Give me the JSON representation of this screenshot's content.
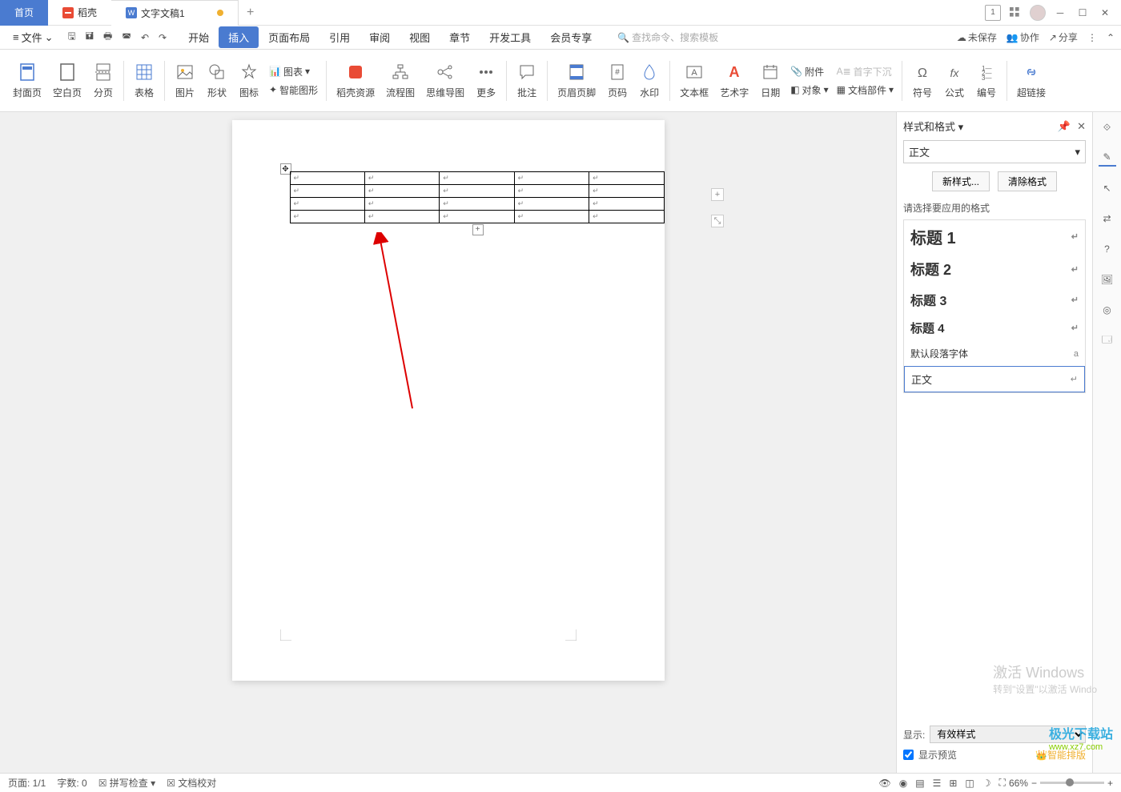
{
  "titlebar": {
    "home": "首页",
    "docer": "稻壳",
    "doc_tab": "文字文稿1",
    "add": "+",
    "badge": "1"
  },
  "menubar": {
    "file": "文件",
    "tabs": [
      "开始",
      "插入",
      "页面布局",
      "引用",
      "审阅",
      "视图",
      "章节",
      "开发工具",
      "会员专享"
    ],
    "active_tab": "插入",
    "search_placeholder": "查找命令、搜索模板",
    "unsaved": "未保存",
    "collab": "协作",
    "share": "分享"
  },
  "ribbon": {
    "cover": "封面页",
    "blank": "空白页",
    "pagebreak": "分页",
    "table": "表格",
    "picture": "图片",
    "shape": "形状",
    "icon": "图标",
    "chart": "图表",
    "smartart": "智能图形",
    "docer_res": "稻壳资源",
    "flowchart": "流程图",
    "mindmap": "思维导图",
    "more": "更多",
    "comment": "批注",
    "headerfooter": "页眉页脚",
    "pagenum": "页码",
    "watermark": "水印",
    "textbox": "文本框",
    "wordart": "艺术字",
    "date": "日期",
    "attachment": "附件",
    "object": "对象",
    "dropcap": "首字下沉",
    "docparts": "文档部件",
    "symbol": "符号",
    "equation": "公式",
    "number": "编号",
    "hyperlink": "超链接"
  },
  "styles_pane": {
    "title": "样式和格式",
    "current": "正文",
    "new_style": "新样式...",
    "clear": "清除格式",
    "hint": "请选择要应用的格式",
    "items": [
      {
        "label": "标题 1",
        "cls": "h1"
      },
      {
        "label": "标题 2",
        "cls": "h2"
      },
      {
        "label": "标题 3",
        "cls": "h3"
      },
      {
        "label": "标题 4",
        "cls": "h4"
      },
      {
        "label": "默认段落字体",
        "cls": "def",
        "mark": "a"
      },
      {
        "label": "正文",
        "cls": "body"
      }
    ],
    "show_label": "显示:",
    "show_value": "有效样式",
    "preview": "显示预览",
    "smart_layout": "智能排版"
  },
  "statusbar": {
    "page": "页面: 1/1",
    "words": "字数: 0",
    "spell": "拼写检查",
    "proof": "文档校对",
    "zoom": "66%"
  },
  "watermark": {
    "activate": "激活 Windows",
    "goto": "转到\"设置\"以激活 Windo",
    "brand1": "极光下载站",
    "brand2": "www.xz7.com"
  }
}
